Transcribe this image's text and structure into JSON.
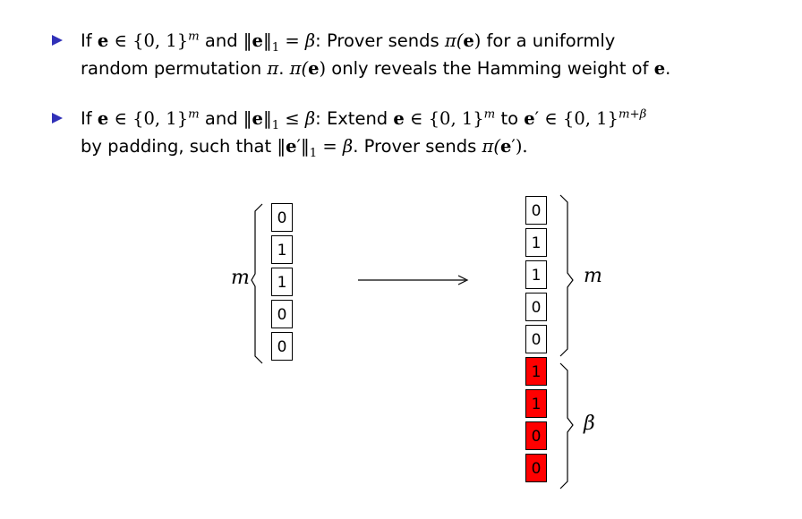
{
  "bullets": [
    {
      "line1": {
        "t1": "If ",
        "e": "e",
        "in": " ∈ {0, 1}",
        "sup": "m",
        "t2": " and ‖",
        "e2": "e",
        "norm": "‖",
        "sub": "1",
        "eq": " = ",
        "beta": "β",
        "t3": ": Prover sends ",
        "pi": "π(",
        "e3": "e",
        "close": ")",
        "t4": " for a uniformly"
      },
      "line2": {
        "t1": "random permutation ",
        "pi": "π",
        "t2": ". ",
        "pi2": "π(",
        "e": "e",
        "close": ")",
        "t3": " only reveals the Hamming weight of ",
        "e2": "e",
        "dot": "."
      }
    },
    {
      "line1": {
        "t1": "If ",
        "e": "e",
        "in": " ∈ {0, 1}",
        "sup": "m",
        "t2": " and ‖",
        "e2": "e",
        "norm": "‖",
        "sub": "1",
        "leq": " ≤ ",
        "beta": "β",
        "t3": ": Extend ",
        "e3": "e",
        "in2": " ∈ {0, 1}",
        "sup2": "m",
        "t4": " to ",
        "ep": "e",
        "prime": "′",
        "in3": " ∈ {0, 1}",
        "sup3": "m+β"
      },
      "line2": {
        "t1": "by padding, such that ‖",
        "e": "e",
        "prime": "′",
        "norm": "‖",
        "sub": "1",
        "eq": " = ",
        "beta": "β",
        "t2": ". Prover sends ",
        "pi": "π(",
        "e2": "e",
        "prime2": "′",
        "close": ")."
      }
    }
  ],
  "left_vector": [
    "0",
    "1",
    "1",
    "0",
    "0"
  ],
  "right_vector_top": [
    "0",
    "1",
    "1",
    "0",
    "0"
  ],
  "right_vector_padding": [
    "1",
    "1",
    "0",
    "0"
  ],
  "padding_color": "#ff0000",
  "bullet_color": "#3131b8",
  "labels": {
    "left_m": "m",
    "right_m": "m",
    "right_beta": "β"
  }
}
